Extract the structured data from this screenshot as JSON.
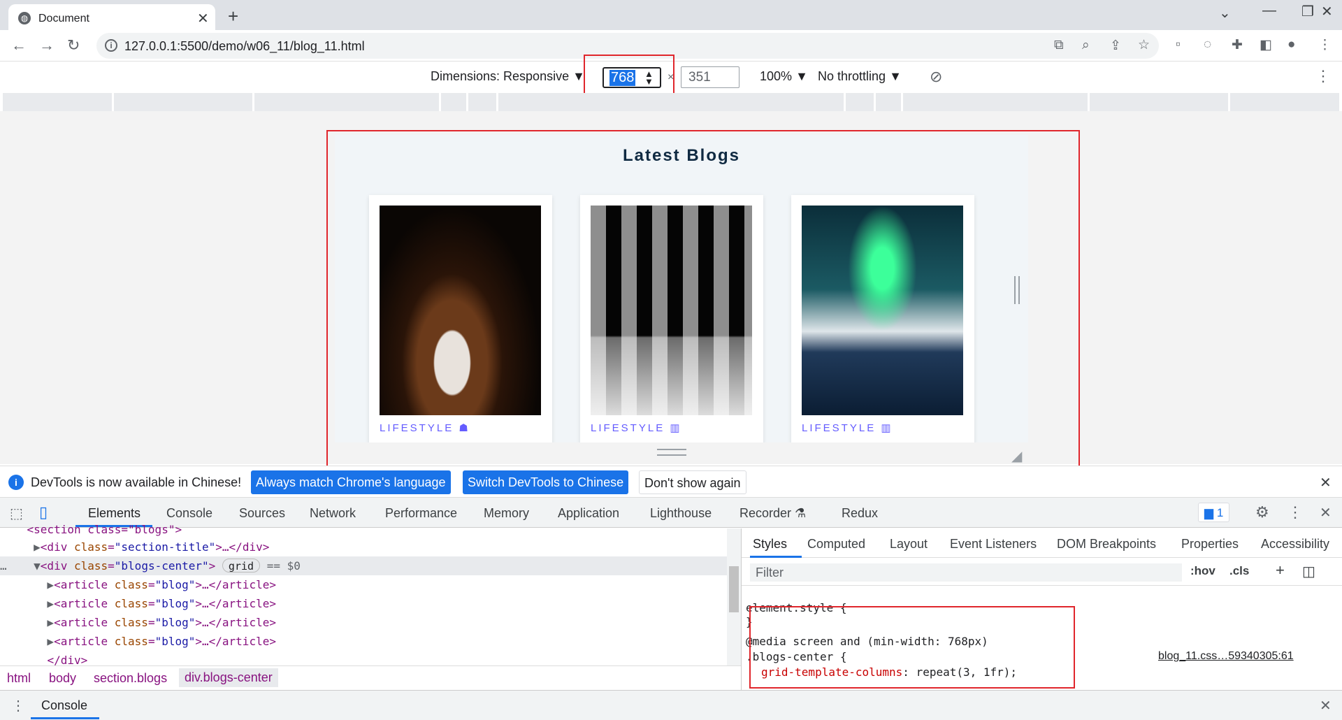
{
  "browser": {
    "tab_title": "Document",
    "url": "127.0.0.1:5500/demo/w06_11/blog_11.html"
  },
  "device_toolbar": {
    "dimensions_label": "Dimensions: Responsive",
    "width": "768",
    "times": "×",
    "height": "351",
    "zoom": "100%",
    "throttling": "No throttling"
  },
  "page": {
    "title": "Latest Blogs",
    "cards": [
      {
        "category": "LIFESTYLE",
        "tag_icon": "ghost-icon",
        "image": "coffee-cup-photo"
      },
      {
        "category": "LIFESTYLE",
        "tag_icon": "barcode-icon",
        "image": "chess-pieces-photo"
      },
      {
        "category": "LIFESTYLE",
        "tag_icon": "barcode-icon",
        "image": "aurora-mountain-photo"
      }
    ],
    "tag_color": "#645cff"
  },
  "infobar": {
    "message": "DevTools is now available in Chinese!",
    "btn_match": "Always match Chrome's language",
    "btn_switch": "Switch DevTools to Chinese",
    "btn_dont": "Don't show again"
  },
  "devtools": {
    "tabs": [
      "Elements",
      "Console",
      "Sources",
      "Network",
      "Performance",
      "Memory",
      "Application",
      "Lighthouse",
      "Recorder",
      "Redux"
    ],
    "issues_count": "1",
    "elements": {
      "line0": "<section class=\"blogs\">",
      "line1_tag_open": "<div ",
      "line1_attr": "class",
      "line1_val": "\"section-title\"",
      "line1_tail": ">…</div>",
      "sel_tag_open": "<div ",
      "sel_attr": "class",
      "sel_val": "\"blogs-center\"",
      "sel_tail": ">",
      "grid_badge": "grid",
      "sel_eq": "== $0",
      "article_tag_open": "<article ",
      "article_attr": "class",
      "article_val": "\"blog\"",
      "article_tail": ">…</article>",
      "close_div": "</div>"
    },
    "breadcrumbs": [
      "html",
      "body",
      "section.blogs",
      "div.blogs-center"
    ],
    "styles_tabs": [
      "Styles",
      "Computed",
      "Layout",
      "Event Listeners",
      "DOM Breakpoints",
      "Properties",
      "Accessibility"
    ],
    "filter_placeholder": "Filter",
    "hov": ":hov",
    "cls": ".cls",
    "rules": {
      "element_style": "element.style {",
      "close_brace": "}",
      "media": "@media screen and (min-width: 768px)",
      "selector": ".blogs-center {",
      "source": "blog_11.css…59340305:61",
      "prop_name": "grid-template-columns",
      "prop_value": ": repeat(3, 1fr);"
    },
    "drawer_tab": "Console"
  }
}
